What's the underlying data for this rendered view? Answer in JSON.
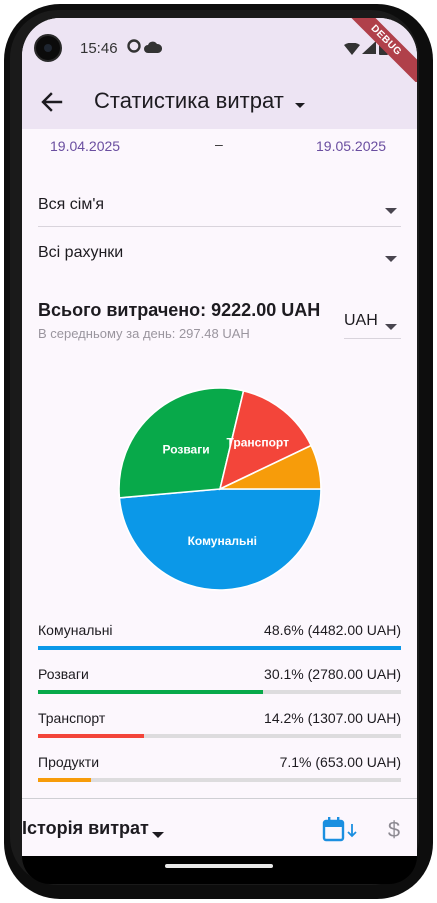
{
  "status_bar": {
    "time": "15:46",
    "debug_label": "DEBUG"
  },
  "app_bar": {
    "title": "Статистика витрат",
    "back_icon": "arrow-back-icon",
    "title_caret_icon": "caret-down-icon"
  },
  "date_range": {
    "from": "19.04.2025",
    "separator": "–",
    "to": "19.05.2025"
  },
  "filters": {
    "family": {
      "value": "Вся сім'я",
      "icon": "caret-down-icon"
    },
    "accounts": {
      "value": "Всі рахунки",
      "icon": "caret-down-icon"
    }
  },
  "summary": {
    "total_label": "Всього витрачено: 9222.00 UAH",
    "average_label": "В середньому за день: 297.48 UAH",
    "currency": "UAH"
  },
  "colors": {
    "accent": "#6a4ea0",
    "communal": "#0b98e8",
    "entertainment": "#08a94a",
    "transport": "#f3453a",
    "groceries": "#f79c0a"
  },
  "chart_data": {
    "type": "pie",
    "categories": [
      "Комунальні",
      "Розваги",
      "Транспорт",
      "Продукти"
    ],
    "values": [
      4482.0,
      2780.0,
      1307.0,
      653.0
    ],
    "percentages": [
      48.6,
      30.1,
      14.2,
      7.1
    ],
    "slice_labels": [
      "Комунальні",
      "Розваги",
      "Транспорт",
      ""
    ],
    "colors": [
      "#0b98e8",
      "#08a94a",
      "#f3453a",
      "#f79c0a"
    ],
    "unit": "UAH"
  },
  "legend": [
    {
      "name": "Комунальні",
      "value_text": "48.6% (4482.00 UAH)",
      "fraction": 1.0,
      "color": "#0b98e8"
    },
    {
      "name": "Розваги",
      "value_text": "30.1% (2780.00 UAH)",
      "fraction": 0.62,
      "color": "#08a94a"
    },
    {
      "name": "Транспорт",
      "value_text": "14.2% (1307.00 UAH)",
      "fraction": 0.292,
      "color": "#f3453a"
    },
    {
      "name": "Продукти",
      "value_text": "7.1% (653.00 UAH)",
      "fraction": 0.146,
      "color": "#f79c0a"
    }
  ],
  "bottom_bar": {
    "history_label": "Історія витрат",
    "calendar_icon": "calendar-sort-icon",
    "currency_icon": "dollar-icon",
    "dollar_glyph": "$"
  }
}
